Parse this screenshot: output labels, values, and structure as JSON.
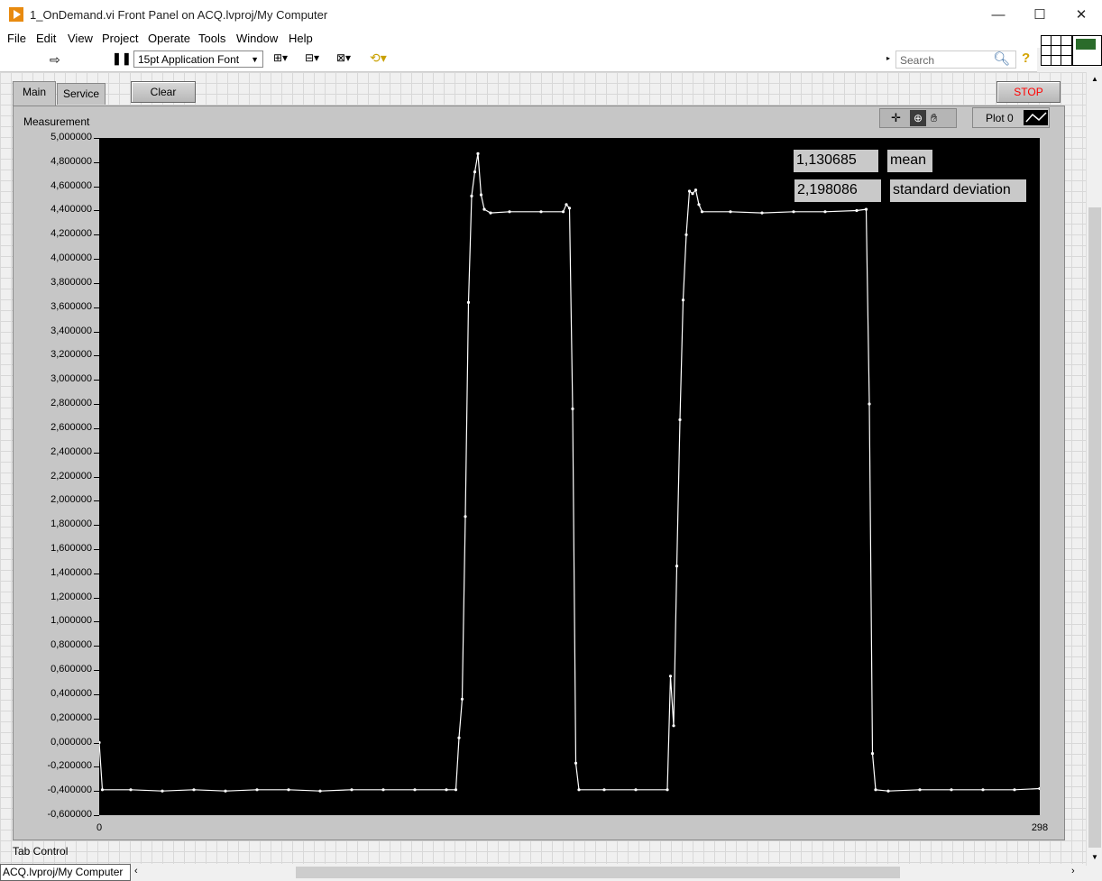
{
  "window": {
    "title": "1_OnDemand.vi Front Panel on ACQ.lvproj/My Computer",
    "minimize": "—",
    "maximize": "☐",
    "close": "✕"
  },
  "menu": [
    "File",
    "Edit",
    "View",
    "Project",
    "Operate",
    "Tools",
    "Window",
    "Help"
  ],
  "toolbar": {
    "font": "15pt Application Font",
    "search_placeholder": "Search"
  },
  "tabs": [
    {
      "label": "Main",
      "active": true
    },
    {
      "label": "Service",
      "active": false
    }
  ],
  "buttons": {
    "clear": "Clear",
    "stop": "STOP"
  },
  "graph": {
    "label": "Measurement",
    "plot_legend": "Plot 0",
    "mean_value": "1,130685",
    "mean_label": "mean",
    "std_value": "2,198086",
    "std_label": "standard deviation",
    "tab_control_label": "Tab Control"
  },
  "status": {
    "context": "ACQ.lvproj/My Computer"
  },
  "colors": {
    "plot_bg": "#000000",
    "trace": "#ffffff",
    "stop_text": "#ff0000",
    "icon_orange": "#e88a0f"
  },
  "chart_data": {
    "type": "line",
    "xlabel": "",
    "ylabel": "",
    "xlim": [
      0,
      298
    ],
    "ylim": [
      -0.6,
      5.0
    ],
    "x_ticks": [
      "0",
      "298"
    ],
    "y_ticks": [
      "5,000000",
      "4,800000",
      "4,600000",
      "4,400000",
      "4,200000",
      "4,000000",
      "3,800000",
      "3,600000",
      "3,400000",
      "3,200000",
      "3,000000",
      "2,800000",
      "2,600000",
      "2,400000",
      "2,200000",
      "2,000000",
      "1,800000",
      "1,600000",
      "1,400000",
      "1,200000",
      "1,000000",
      "0,800000",
      "0,600000",
      "0,400000",
      "0,200000",
      "0,000000",
      "-0,200000",
      "-0,400000",
      "-0,600000"
    ],
    "grid": false,
    "series": [
      {
        "points": [
          [
            0,
            0.0
          ],
          [
            1,
            -0.39
          ],
          [
            10,
            -0.39
          ],
          [
            20,
            -0.4
          ],
          [
            30,
            -0.39
          ],
          [
            40,
            -0.4
          ],
          [
            50,
            -0.39
          ],
          [
            60,
            -0.39
          ],
          [
            70,
            -0.4
          ],
          [
            80,
            -0.39
          ],
          [
            90,
            -0.39
          ],
          [
            100,
            -0.39
          ],
          [
            110,
            -0.39
          ],
          [
            113,
            -0.39
          ],
          [
            114,
            0.04
          ],
          [
            115,
            0.36
          ],
          [
            116,
            1.87
          ],
          [
            117,
            3.64
          ],
          [
            118,
            4.52
          ],
          [
            119,
            4.72
          ],
          [
            120,
            4.87
          ],
          [
            121,
            4.53
          ],
          [
            122,
            4.41
          ],
          [
            124,
            4.38
          ],
          [
            130,
            4.39
          ],
          [
            140,
            4.39
          ],
          [
            147,
            4.39
          ],
          [
            148,
            4.45
          ],
          [
            149,
            4.42
          ],
          [
            150,
            2.76
          ],
          [
            151,
            -0.17
          ],
          [
            152,
            -0.39
          ],
          [
            160,
            -0.39
          ],
          [
            170,
            -0.39
          ],
          [
            180,
            -0.39
          ],
          [
            181,
            0.55
          ],
          [
            182,
            0.14
          ],
          [
            183,
            1.46
          ],
          [
            184,
            2.67
          ],
          [
            185,
            3.66
          ],
          [
            186,
            4.2
          ],
          [
            187,
            4.56
          ],
          [
            188,
            4.54
          ],
          [
            189,
            4.57
          ],
          [
            190,
            4.45
          ],
          [
            191,
            4.39
          ],
          [
            200,
            4.39
          ],
          [
            210,
            4.38
          ],
          [
            220,
            4.39
          ],
          [
            230,
            4.39
          ],
          [
            240,
            4.4
          ],
          [
            243,
            4.41
          ],
          [
            244,
            2.8
          ],
          [
            245,
            -0.09
          ],
          [
            246,
            -0.39
          ],
          [
            250,
            -0.4
          ],
          [
            260,
            -0.39
          ],
          [
            270,
            -0.39
          ],
          [
            280,
            -0.39
          ],
          [
            290,
            -0.39
          ],
          [
            298,
            -0.38
          ]
        ]
      }
    ]
  }
}
